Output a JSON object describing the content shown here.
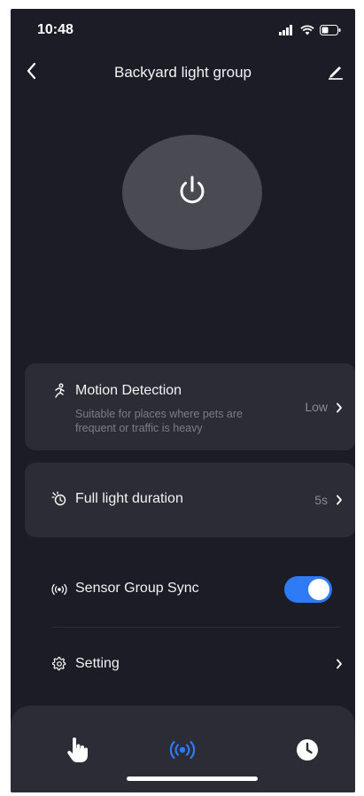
{
  "status_bar": {
    "time": "10:48",
    "signal_icon": "signal-icon",
    "wifi_icon": "wifi-icon",
    "battery_icon": "battery-icon"
  },
  "header": {
    "title": "Backyard light group",
    "back_icon": "chevron-left-icon",
    "edit_icon": "pencil-icon"
  },
  "power": {
    "icon": "power-icon"
  },
  "motion_detection": {
    "title": "Motion Detection",
    "description": "Suitable for places where pets are frequent or traffic is heavy",
    "value": "Low",
    "icon": "running-person-icon"
  },
  "full_light_duration": {
    "title": "Full light duration",
    "value": "5s",
    "icon": "timer-sun-icon"
  },
  "sensor_group_sync": {
    "title": "Sensor Group Sync",
    "enabled": true,
    "icon": "broadcast-icon"
  },
  "setting": {
    "title": "Setting",
    "icon": "gear-icon"
  },
  "bottom_nav": {
    "items": [
      {
        "icon": "hand-pointer-icon",
        "active": false
      },
      {
        "icon": "sensor-wave-icon",
        "active": true
      },
      {
        "icon": "clock-icon",
        "active": false
      }
    ]
  },
  "colors": {
    "background": "#1c1c26",
    "card": "#2c2c36",
    "accent": "#2f7bf5",
    "power_button": "#4a4a52"
  }
}
